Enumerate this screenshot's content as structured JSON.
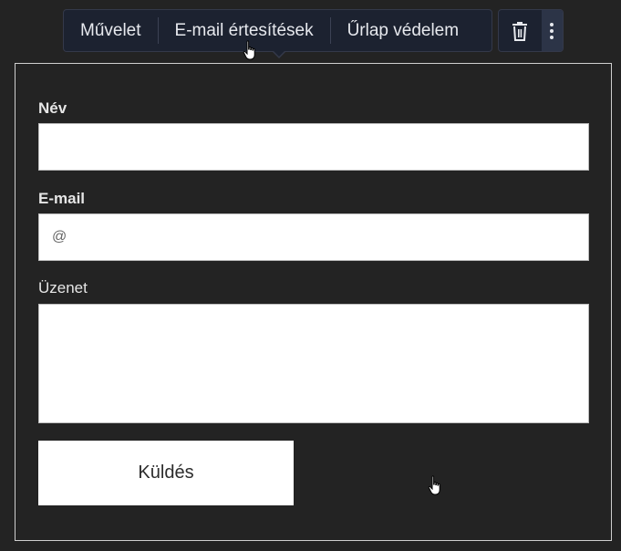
{
  "toolbar": {
    "action_label": "Művelet",
    "email_notifications_label": "E-mail értesítések",
    "form_protection_label": "Űrlap védelem"
  },
  "form": {
    "name_label": "Név",
    "email_label": "E-mail",
    "email_placeholder": "@",
    "message_label": "Üzenet",
    "submit_label": "Küldés"
  },
  "colors": {
    "background": "#232323",
    "toolbar_bg": "#1c2230",
    "field_bg": "#ffffff"
  }
}
